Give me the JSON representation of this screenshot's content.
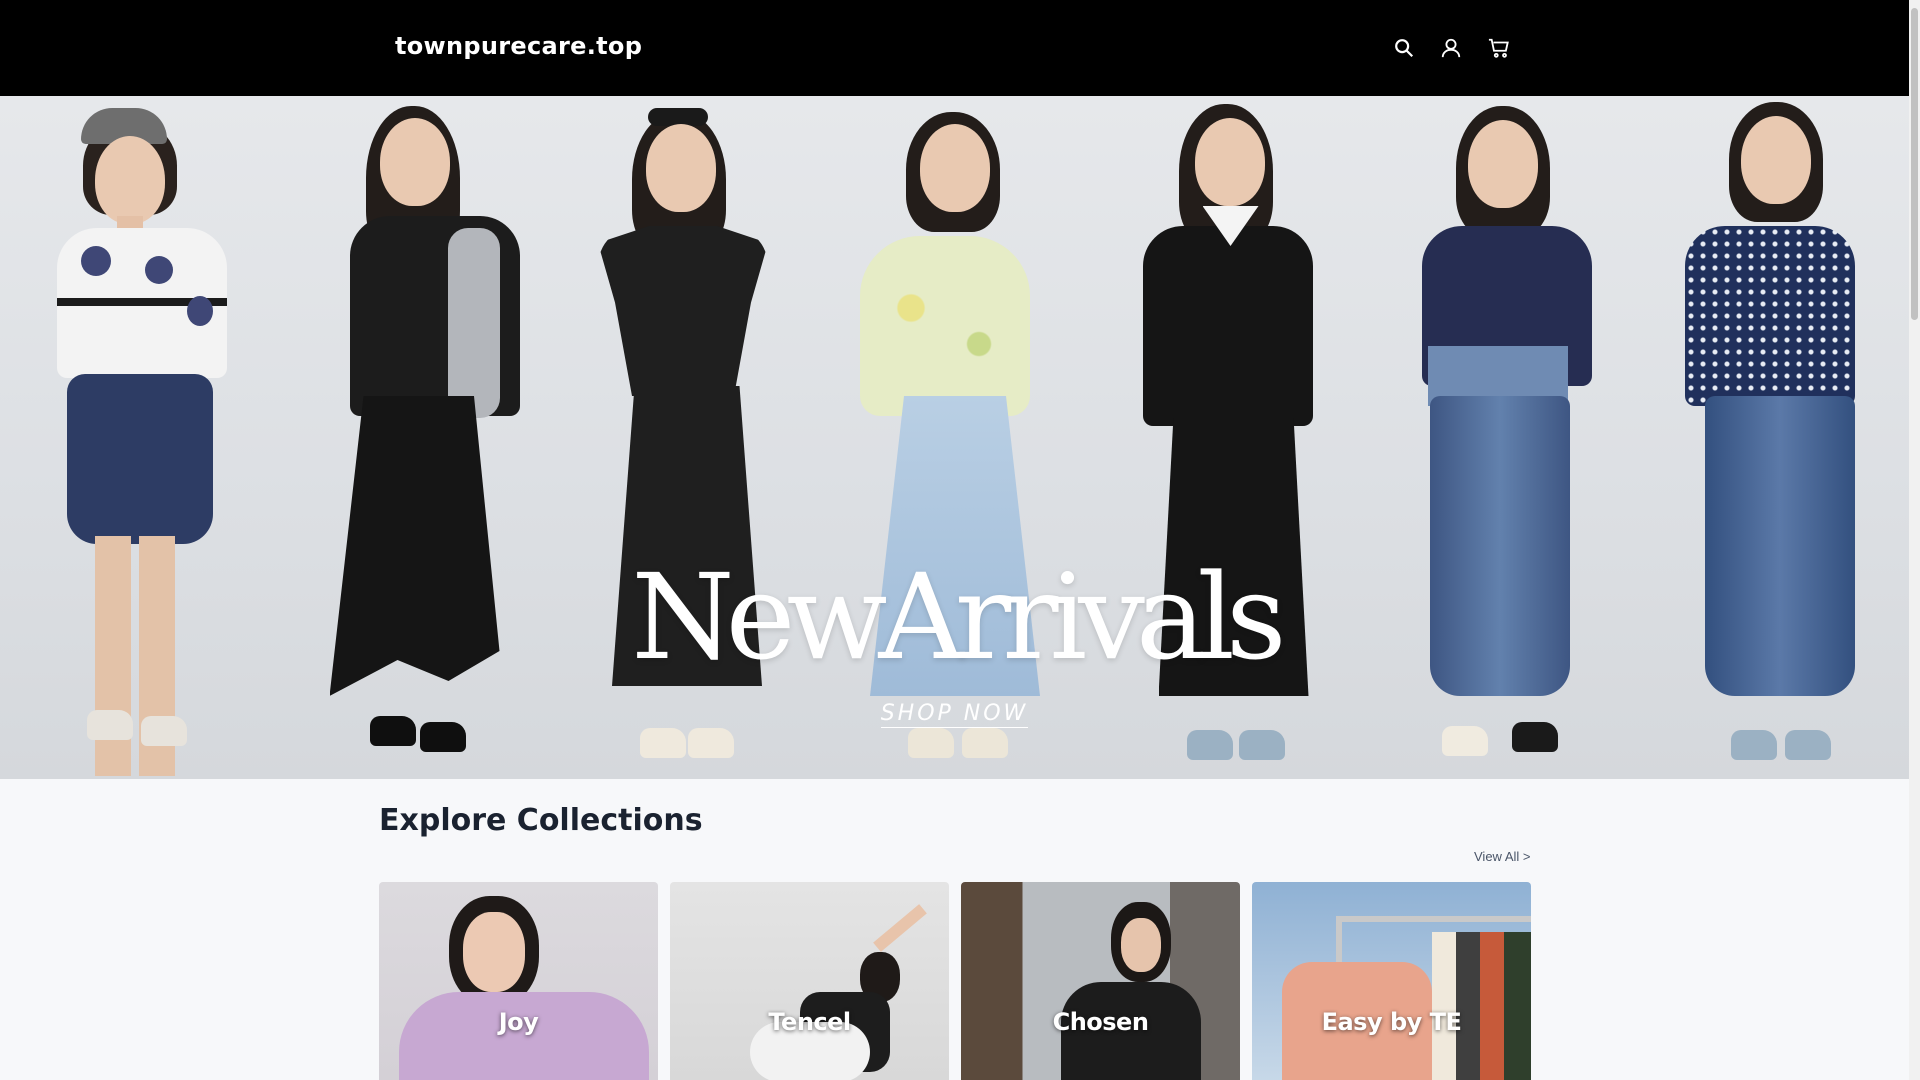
{
  "header": {
    "logo": "townpurecare.top",
    "icons": [
      "search-icon",
      "account-icon",
      "cart-icon"
    ]
  },
  "hero": {
    "title": "NewArrivals",
    "cta": "SHOP NOW",
    "outfits": [
      {
        "name": "polka-dot-stripe-top-denim-skirt",
        "top": "#f2f2f2",
        "bottom": "#2d3c64"
      },
      {
        "name": "black-vest-grey-sleeve-skirt",
        "top": "#1c1c1c",
        "bottom": "#161616"
      },
      {
        "name": "black-v-neck-dress",
        "top": "#1e1e1e",
        "bottom": "#1e1e1e"
      },
      {
        "name": "floral-blouse-light-denim-skirt",
        "top": "#dfe7b5",
        "bottom": "#a8c2dc"
      },
      {
        "name": "black-collar-button-dress",
        "top": "#141414",
        "bottom": "#141414"
      },
      {
        "name": "navy-top-denim-skirt",
        "top": "#262d52",
        "bottom": "#4c6794"
      },
      {
        "name": "navy-polka-dot-top-denim-skirt",
        "top": "#20305c",
        "bottom": "#3e5a8e"
      }
    ]
  },
  "collections": {
    "title": "Explore Collections",
    "view_all": "View All >",
    "items": [
      {
        "label": "Joy",
        "bg": "#d9d6dc",
        "accent": "#c9a9d4"
      },
      {
        "label": "Tencel",
        "bg": "#dedede",
        "accent": "#1d1d1d"
      },
      {
        "label": "Chosen",
        "bg": "#8e8074",
        "accent": "#1c1c1c"
      },
      {
        "label": "Easy by TE",
        "bg": "#7fa3c8",
        "accent": "#e8a48c"
      }
    ]
  },
  "colors": {
    "header_bg": "#000000",
    "page_bg": "#f7f8fa",
    "heading": "#1a2230"
  }
}
